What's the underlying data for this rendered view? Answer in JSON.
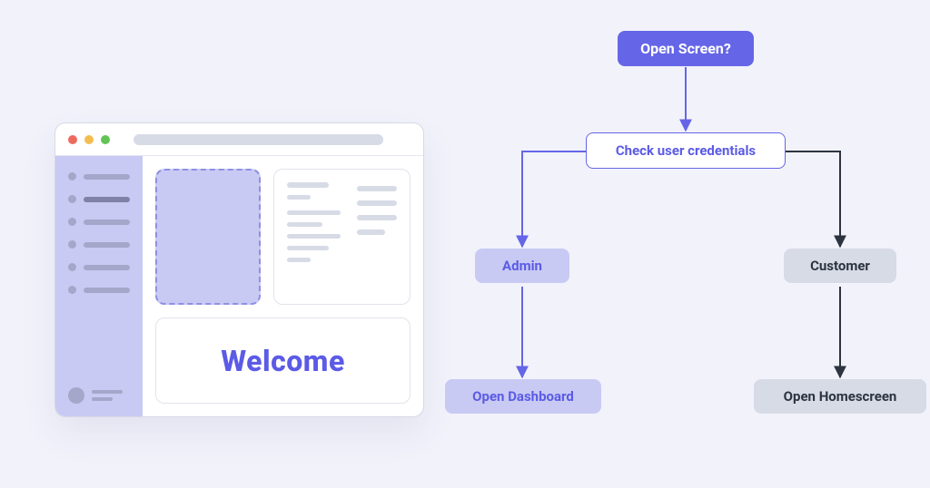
{
  "mockup": {
    "welcome_label": "Welcome"
  },
  "flow": {
    "open_screen": "Open Screen?",
    "check": "Check user credentials",
    "admin": "Admin",
    "customer": "Customer",
    "dashboard": "Open Dashboard",
    "homescreen": "Open Homescreen"
  },
  "colors": {
    "accent": "#6565e8",
    "accent_text": "#5b5be6",
    "light_purple": "#c8caf3",
    "grey": "#d7dbe6",
    "dark_text": "#2c3440"
  }
}
